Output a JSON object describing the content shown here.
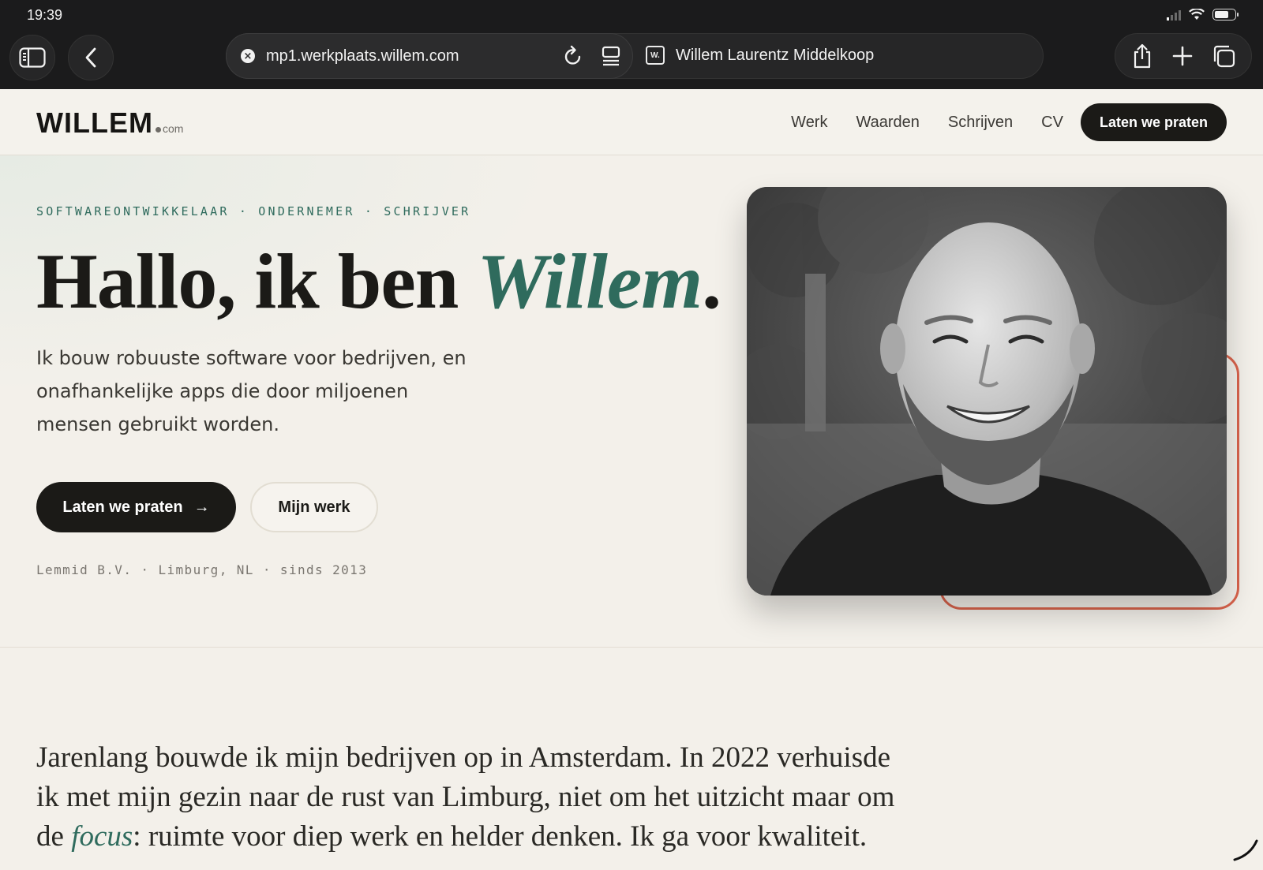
{
  "status_bar": {
    "time": "19:39",
    "battery_level": 0.7
  },
  "browser": {
    "url": "mp1.werkplaats.willem.com",
    "tab_favicon_text": "W.",
    "tab_title": "Willem Laurentz Middelkoop"
  },
  "site": {
    "logo": {
      "main": "WILLEM",
      "suffix": "com"
    },
    "nav": [
      "Werk",
      "Waarden",
      "Schrijven",
      "CV"
    ],
    "nav_cta": "Laten we praten"
  },
  "hero": {
    "kicker": "SOFTWAREONTWIKKELAAR · ONDERNEMER · SCHRIJVER",
    "headline_prefix": "Hallo, ik ben ",
    "headline_name": "Willem",
    "headline_suffix": ".",
    "lead": "Ik bouw robuuste software voor bedrijven, en onafhankelijke apps die door miljoenen mensen gebruikt worden.",
    "primary_button": "Laten we praten",
    "primary_button_arrow": "→",
    "secondary_button": "Mijn werk",
    "meta": "Lemmid B.V. · Limburg, NL · sinds 2013"
  },
  "intro": {
    "text_before": "Jarenlang bouwde ik mijn bedrijven op in Amsterdam. In 2022 verhuisde ik met mijn gezin naar de rust van Limburg, niet om het uitzicht maar om de ",
    "emphasis": "focus",
    "text_after": ": ruimte voor diep werk en helder denken. Ik ga voor kwaliteit."
  },
  "colors": {
    "accent_green": "#2f6b5d",
    "accent_coral": "#d9634c",
    "ink": "#1b1a17",
    "paper": "#f3f0ea"
  }
}
